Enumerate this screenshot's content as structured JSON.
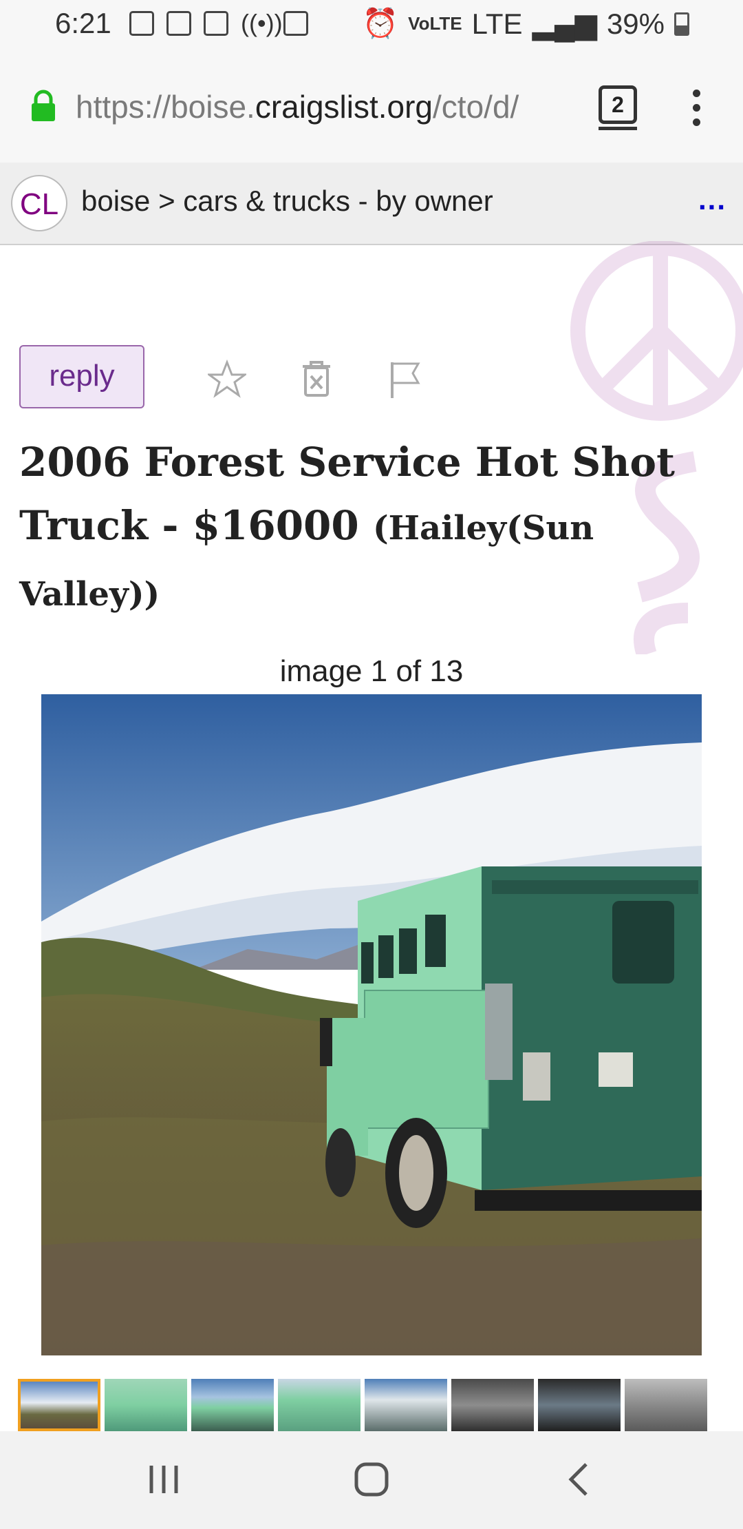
{
  "status_bar": {
    "time": "6:21",
    "network_label": "LTE",
    "volte_label": "VoLTE",
    "battery": "39%"
  },
  "browser": {
    "url_prefix": "https://boise.",
    "url_domain": "craigslist.org",
    "url_suffix": "/cto/d/",
    "tab_count": "2"
  },
  "breadcrumb": {
    "logo": "CL",
    "path": "boise > cars & trucks - by owner",
    "more": "..."
  },
  "actions": {
    "reply_label": "reply"
  },
  "posting": {
    "title": "2006 Forest Service Hot Shot Truck - $16000",
    "location": "(Hailey(Sun Valley))",
    "image_counter": "image 1 of 13"
  },
  "colors": {
    "reply_bg": "#f0e6f6",
    "reply_text": "#6a2b8c",
    "lock": "#22bb22",
    "active_thumb": "#f0a020"
  }
}
